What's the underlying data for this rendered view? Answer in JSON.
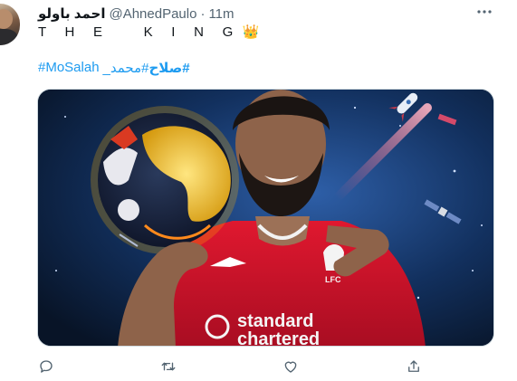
{
  "tweet": {
    "display_name": "احمد باولو",
    "handle": "@AhnedPaulo",
    "separator": "·",
    "time": "11m",
    "text": "T H E   K I N G",
    "crown_emoji": "👑",
    "hashtags": [
      "#MoSalah",
      "_محمد#",
      "صلاح#"
    ]
  },
  "media": {
    "alt_icons": [
      "world-ball-icon",
      "rocket-icon",
      "satellite-icon"
    ],
    "shirt_text_line1": "standard",
    "shirt_text_line2": "chartered",
    "crest_text": "LFC"
  },
  "actions": {
    "icons": [
      "reply-icon",
      "retweet-icon",
      "like-icon",
      "share-icon"
    ]
  },
  "colors": {
    "link": "#1d9bf0",
    "secondary_text": "#536471",
    "action_icon": "#536471",
    "jersey_red": "#c8102e"
  }
}
